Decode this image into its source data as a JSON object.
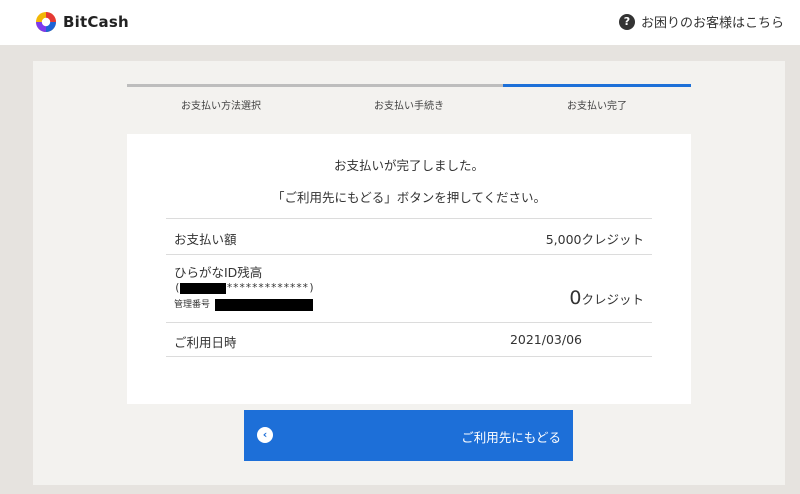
{
  "header": {
    "logo_text": "BitCash",
    "help_text": "お困りのお客様はこちら",
    "help_icon": "question-circle-icon"
  },
  "steps": [
    {
      "label": "お支払い方法選択",
      "active": false
    },
    {
      "label": "お支払い手続き",
      "active": false
    },
    {
      "label": "お支払い完了",
      "active": true
    }
  ],
  "message": {
    "line1": "お支払いが完了しました。",
    "line2": "「ご利用先にもどる」ボタンを押してください。"
  },
  "details": {
    "amount_label": "お支払い額",
    "amount_value": "5,000クレジット",
    "balance_label": "ひらがなID残高",
    "id_mask": "*************",
    "paren_open": "(",
    "paren_close": ")",
    "mgmt_label": "管理番号",
    "balance_number": "0",
    "balance_unit": "クレジット",
    "date_label": "ご利用日時",
    "date_value": "2021/03/06"
  },
  "button": {
    "label": "ご利用先にもどる",
    "icon": "chevron-left-circle-icon"
  },
  "colors": {
    "accent": "#1d6fd8",
    "background": "#e6e3df",
    "panel": "#f3f2ef"
  }
}
